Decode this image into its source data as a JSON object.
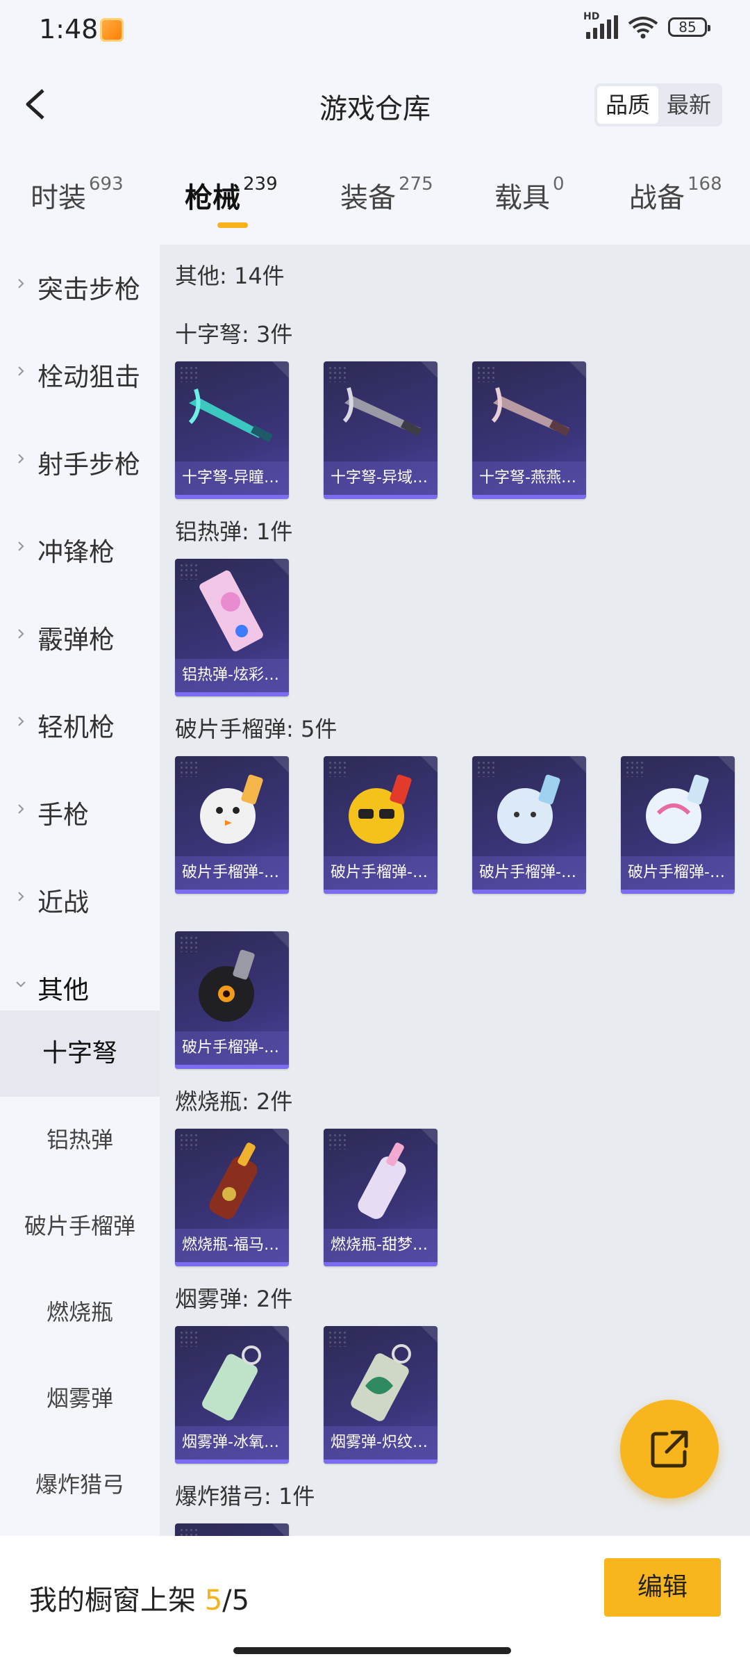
{
  "status_bar": {
    "time": "1:48",
    "network": "HD",
    "battery": "85"
  },
  "header": {
    "title": "游戏仓库",
    "sort": {
      "quality": "品质",
      "latest": "最新"
    }
  },
  "tabs": [
    {
      "label": "时装",
      "count": "693"
    },
    {
      "label": "枪械",
      "count": "239"
    },
    {
      "label": "装备",
      "count": "275"
    },
    {
      "label": "载具",
      "count": "0"
    },
    {
      "label": "战备",
      "count": "168"
    }
  ],
  "sidebar": {
    "categories": [
      "突击步枪",
      "栓动狙击",
      "射手步枪",
      "冲锋枪",
      "霰弹枪",
      "轻机枪",
      "手枪",
      "近战",
      "其他"
    ],
    "subcategories": [
      "十字弩",
      "铝热弹",
      "破片手榴弹",
      "燃烧瓶",
      "烟雾弹",
      "爆炸猎弓"
    ]
  },
  "main": {
    "total": "其他: 14件",
    "sections": [
      {
        "title": "十字弩: 3件",
        "items": [
          "十字弩-异瞳…",
          "十字弩-异域…",
          "十字弩-燕燕…"
        ]
      },
      {
        "title": "铝热弹: 1件",
        "items": [
          "铝热弹-炫彩…"
        ]
      },
      {
        "title": "破片手榴弹: 5件",
        "items": [
          "破片手榴弹-…",
          "破片手榴弹-…",
          "破片手榴弹-…",
          "破片手榴弹-…",
          "破片手榴弹-…"
        ]
      },
      {
        "title": "燃烧瓶: 2件",
        "items": [
          "燃烧瓶-福马…",
          "燃烧瓶-甜梦…"
        ]
      },
      {
        "title": "烟雾弹: 2件",
        "items": [
          "烟雾弹-冰氧…",
          "烟雾弹-炽纹…"
        ]
      },
      {
        "title": "爆炸猎弓: 1件",
        "items": []
      }
    ]
  },
  "bottom": {
    "label": "我的橱窗上架",
    "count": "5",
    "total": "/5",
    "edit": "编辑"
  },
  "colors": {
    "accent": "#f8b51e",
    "card": "#3a3478"
  }
}
